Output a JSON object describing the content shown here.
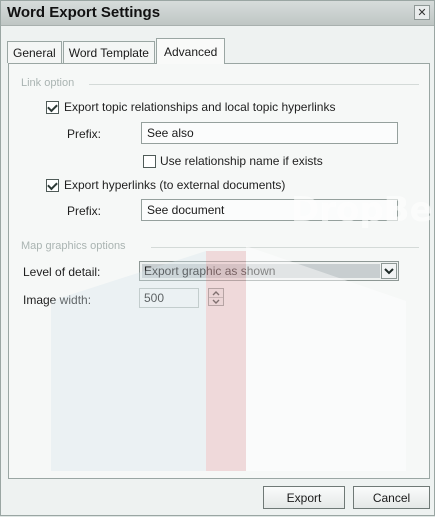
{
  "window": {
    "title": "Word Export Settings",
    "close_icon": "close-icon"
  },
  "tabs": [
    {
      "label": "General"
    },
    {
      "label": "Word Template"
    },
    {
      "label": "Advanced",
      "active": true
    }
  ],
  "link_option": {
    "group_label": "Link option",
    "export_relationships": {
      "label": "Export topic relationships and local topic hyperlinks",
      "checked": true
    },
    "prefix1_label": "Prefix:",
    "prefix1_value": "See also",
    "use_relationship_name": {
      "label": "Use relationship name if exists",
      "checked": false
    },
    "export_hyperlinks": {
      "label": "Export hyperlinks (to external documents)",
      "checked": true
    },
    "prefix2_label": "Prefix:",
    "prefix2_value": "See document"
  },
  "map_graphics": {
    "group_label": "Map graphics options",
    "level_label": "Level of detail:",
    "level_value": "Export graphic as shown",
    "width_label": "Image width:",
    "width_value": "500"
  },
  "buttons": {
    "export": "Export",
    "cancel": "Cancel"
  },
  "watermark": {
    "text": "DropBe"
  }
}
